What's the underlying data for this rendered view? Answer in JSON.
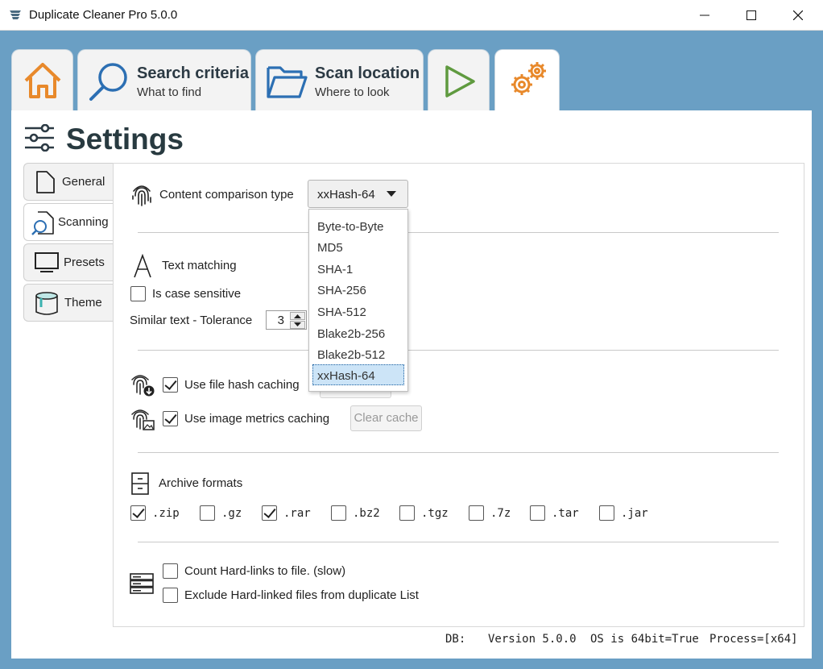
{
  "window": {
    "title": "Duplicate Cleaner Pro 5.0.0",
    "minimize_glyph": "—",
    "maximize_glyph": "☐",
    "close_glyph": "✕"
  },
  "tabs": [
    {
      "id": "home",
      "icon": "home-icon"
    },
    {
      "id": "search",
      "icon": "search-icon",
      "label": "Search criteria",
      "sub": "What to find"
    },
    {
      "id": "scan",
      "icon": "folder-icon",
      "label": "Scan location",
      "sub": "Where to look"
    },
    {
      "id": "run",
      "icon": "play-icon"
    },
    {
      "id": "settings",
      "icon": "gears-icon",
      "active": true
    }
  ],
  "page": {
    "title": "Settings"
  },
  "sidebar": {
    "items": [
      {
        "label": "General",
        "icon": "document-icon"
      },
      {
        "label": "Scanning",
        "icon": "scan-search-icon",
        "active": true
      },
      {
        "label": "Presets",
        "icon": "monitor-icon"
      },
      {
        "label": "Theme",
        "icon": "paint-bucket-icon"
      }
    ]
  },
  "content_comparison": {
    "label": "Content comparison type",
    "value": "xxHash-64",
    "options": [
      "Byte-to-Byte",
      "MD5",
      "SHA-1",
      "SHA-256",
      "SHA-512",
      "Blake2b-256",
      "Blake2b-512",
      "xxHash-64"
    ],
    "selected": "xxHash-64"
  },
  "text_matching": {
    "label": "Text matching",
    "case_sensitive": {
      "label": "Is case sensitive",
      "checked": false
    },
    "similar_text_label": "Similar text  -  Tolerance",
    "tolerance": "3"
  },
  "caching": {
    "file_hash": {
      "label": "Use file hash caching",
      "checked": true
    },
    "image_metrics": {
      "label": "Use image metrics caching",
      "checked": true
    },
    "clear_cache_label": "Clear cache"
  },
  "archive": {
    "label": "Archive formats",
    "formats": [
      {
        "label": ".zip",
        "checked": true
      },
      {
        "label": ".gz",
        "checked": false
      },
      {
        "label": ".rar",
        "checked": true
      },
      {
        "label": ".bz2",
        "checked": false
      },
      {
        "label": ".tgz",
        "checked": false
      },
      {
        "label": ".7z",
        "checked": false
      },
      {
        "label": ".tar",
        "checked": false
      },
      {
        "label": ".jar",
        "checked": false
      }
    ]
  },
  "hardlinks": {
    "count": {
      "label": "Count Hard-links to file. (slow)",
      "checked": false
    },
    "exclude": {
      "label": "Exclude Hard-linked files from duplicate List",
      "checked": false
    }
  },
  "status_bar": {
    "db": "DB:",
    "version": "Version 5.0.0",
    "os": "OS is 64bit=True",
    "process": "Process=[x64]"
  },
  "colors": {
    "accent_orange": "#e8892b",
    "accent_blue": "#2c6fb3",
    "accent_green": "#5f9a3f",
    "background_blue": "#6a9fc4",
    "selection": "#cce4f7"
  }
}
